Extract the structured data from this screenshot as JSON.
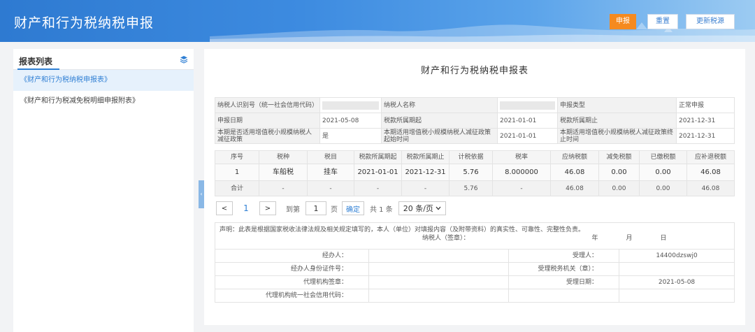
{
  "header": {
    "title": "财产和行为税纳税申报",
    "buttons": {
      "declare": "申报",
      "reset": "重置",
      "update_source": "更新税源"
    }
  },
  "sidebar": {
    "title": "报表列表",
    "items": [
      {
        "label": "《财产和行为税纳税申报表》"
      },
      {
        "label": "《财产和行为税减免税明细申报附表》"
      }
    ]
  },
  "form": {
    "title": "财产和行为税纳税申报表",
    "info": {
      "taxpayer_id_label": "纳税人识别号（统一社会信用代码）",
      "taxpayer_name_label": "纳税人名称",
      "declare_type_label": "申报类型",
      "declare_type_value": "正常申报",
      "declare_date_label": "申报日期",
      "declare_date_value": "2021-05-08",
      "period_start_label": "税款所属期起",
      "period_start_value": "2021-01-01",
      "period_end_label": "税款所属期止",
      "period_end_value": "2021-12-31",
      "small_scale_label": "本期是否适用增值税小规模纳税人减征政策",
      "small_scale_value": "是",
      "policy_start_label": "本期适用增值税小规模纳税人减征政策起始时间",
      "policy_start_value": "2021-01-01",
      "policy_end_label": "本期适用增值税小规模纳税人减征政策终止时间",
      "policy_end_value": "2021-12-31"
    },
    "columns": [
      "序号",
      "税种",
      "税目",
      "税款所属期起",
      "税款所属期止",
      "计税依据",
      "税率",
      "应纳税额",
      "减免税额",
      "已缴税额",
      "应补退税额"
    ],
    "rows": [
      [
        "1",
        "车船税",
        "挂车",
        "2021-01-01",
        "2021-12-31",
        "5.76",
        "8.000000",
        "46.08",
        "0.00",
        "0.00",
        "46.08"
      ]
    ],
    "total": [
      "合计",
      "-",
      "-",
      "-",
      "-",
      "5.76",
      "-",
      "46.08",
      "0.00",
      "0.00",
      "46.08"
    ]
  },
  "pagination": {
    "prev": "<",
    "current": "1",
    "next": ">",
    "goto_label": "到第",
    "goto_value": "1",
    "page_unit": "页",
    "confirm": "确定",
    "total": "共 1 条",
    "page_size": "20 条/页"
  },
  "declaration": {
    "statement": "声明：此表是根据国家税收法律法规及相关规定填写的，本人（单位）对填报内容（及附带资料）的真实性、可靠性、完整性负责。",
    "signature": "纳税人（签章）：",
    "year": "年",
    "month": "月",
    "day": "日",
    "handler_label": "经办人：",
    "handler_id_label": "经办人身份证件号：",
    "agent_seal_label": "代理机构签章：",
    "agent_credit_label": "代理机构统一社会信用代码：",
    "receiver_label": "受理人：",
    "receiver_value": "14400dzswj0",
    "tax_office_label": "受理税务机关（章）：",
    "accept_date_label": "受理日期：",
    "accept_date_value": "2021-05-08"
  }
}
